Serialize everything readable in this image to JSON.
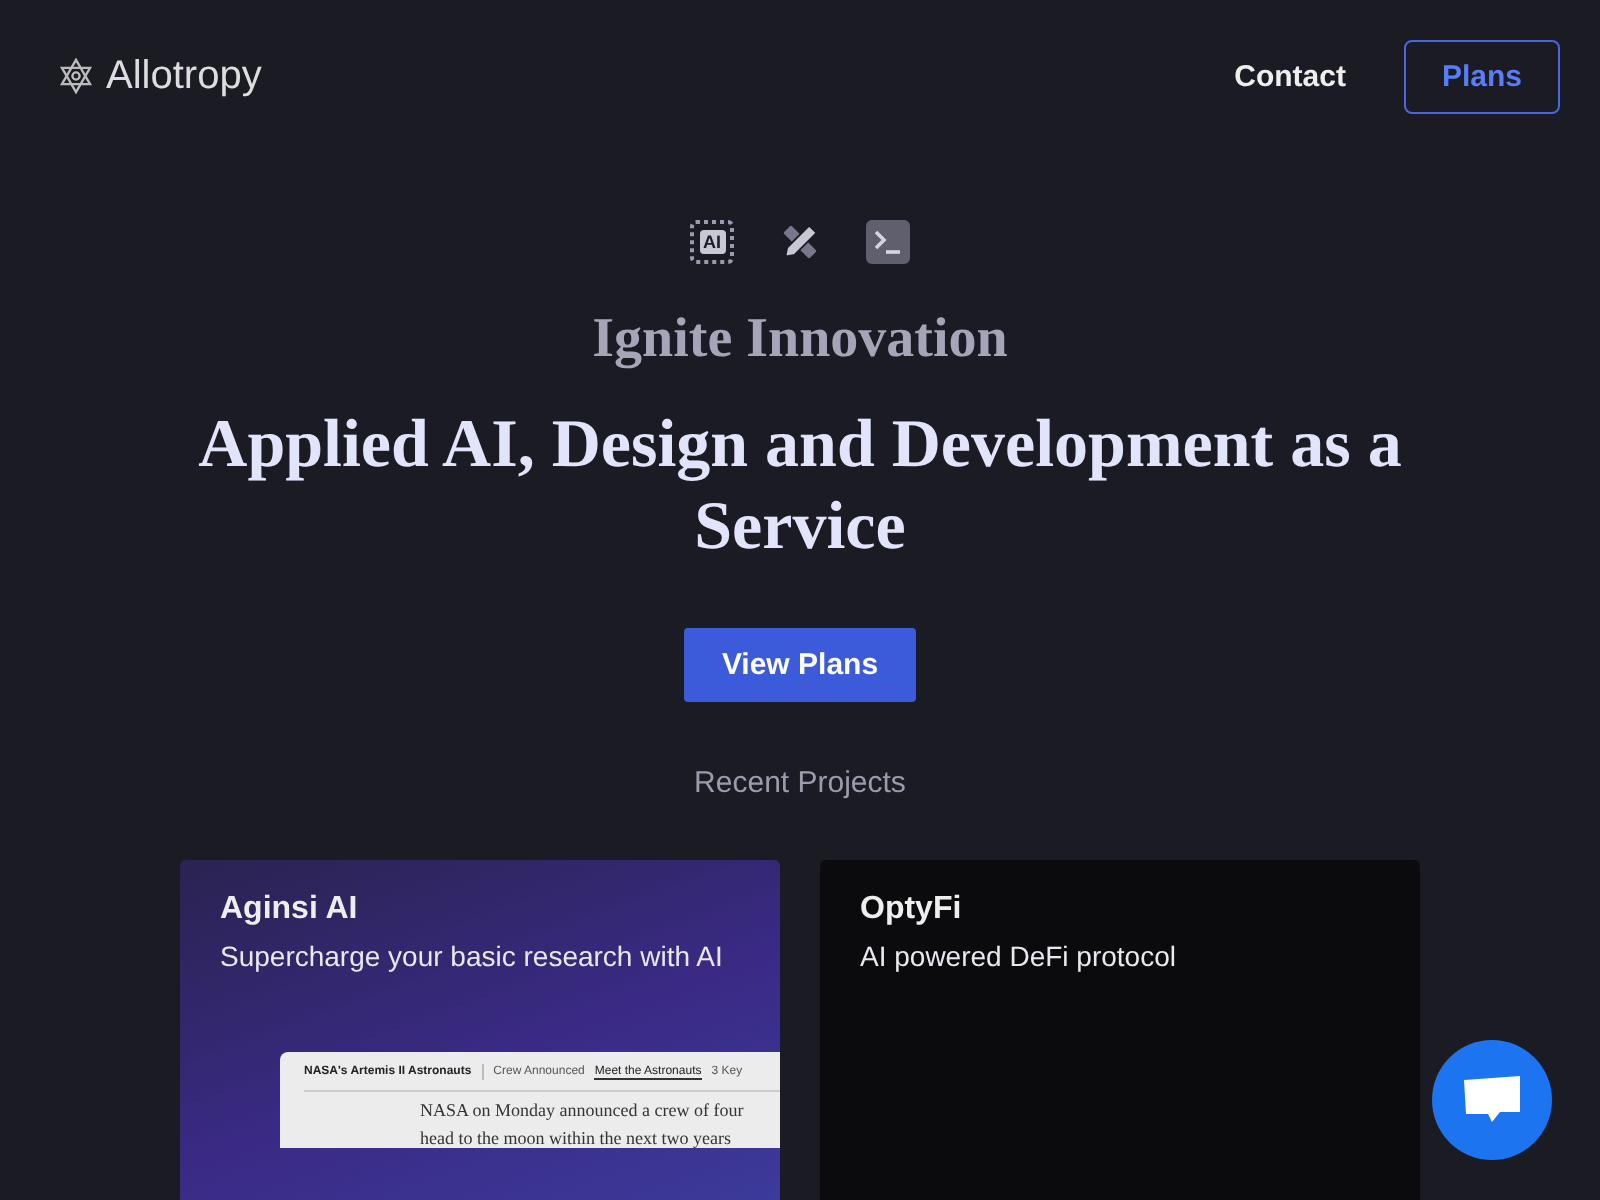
{
  "header": {
    "logo": "Allotropy",
    "nav": [
      {
        "label": "Contact",
        "kind": "link"
      },
      {
        "label": "Plans",
        "kind": "outline"
      }
    ]
  },
  "hero": {
    "eyebrow": "Ignite Innovation",
    "title": "Applied AI, Design and Development as a Service",
    "chip_label": "AI",
    "cta": "View Plans"
  },
  "projects": {
    "heading": "Recent Projects",
    "items": [
      {
        "title": "Aginsi AI",
        "description": "Supercharge your basic research with AI",
        "kind": "gradient",
        "preview": {
          "title": "NASA's Artemis II Astronauts",
          "tabs": [
            {
              "label": "Crew Announced",
              "selected": false
            },
            {
              "label": "Meet the Astronauts",
              "selected": true
            },
            {
              "label": "3 Key",
              "selected": false
            }
          ],
          "lines": [
            "NASA on Monday announced a crew of four",
            "head to the moon within the next two years"
          ]
        }
      },
      {
        "title": "OptyFi",
        "description": "AI powered DeFi protocol",
        "kind": "dark"
      }
    ]
  }
}
